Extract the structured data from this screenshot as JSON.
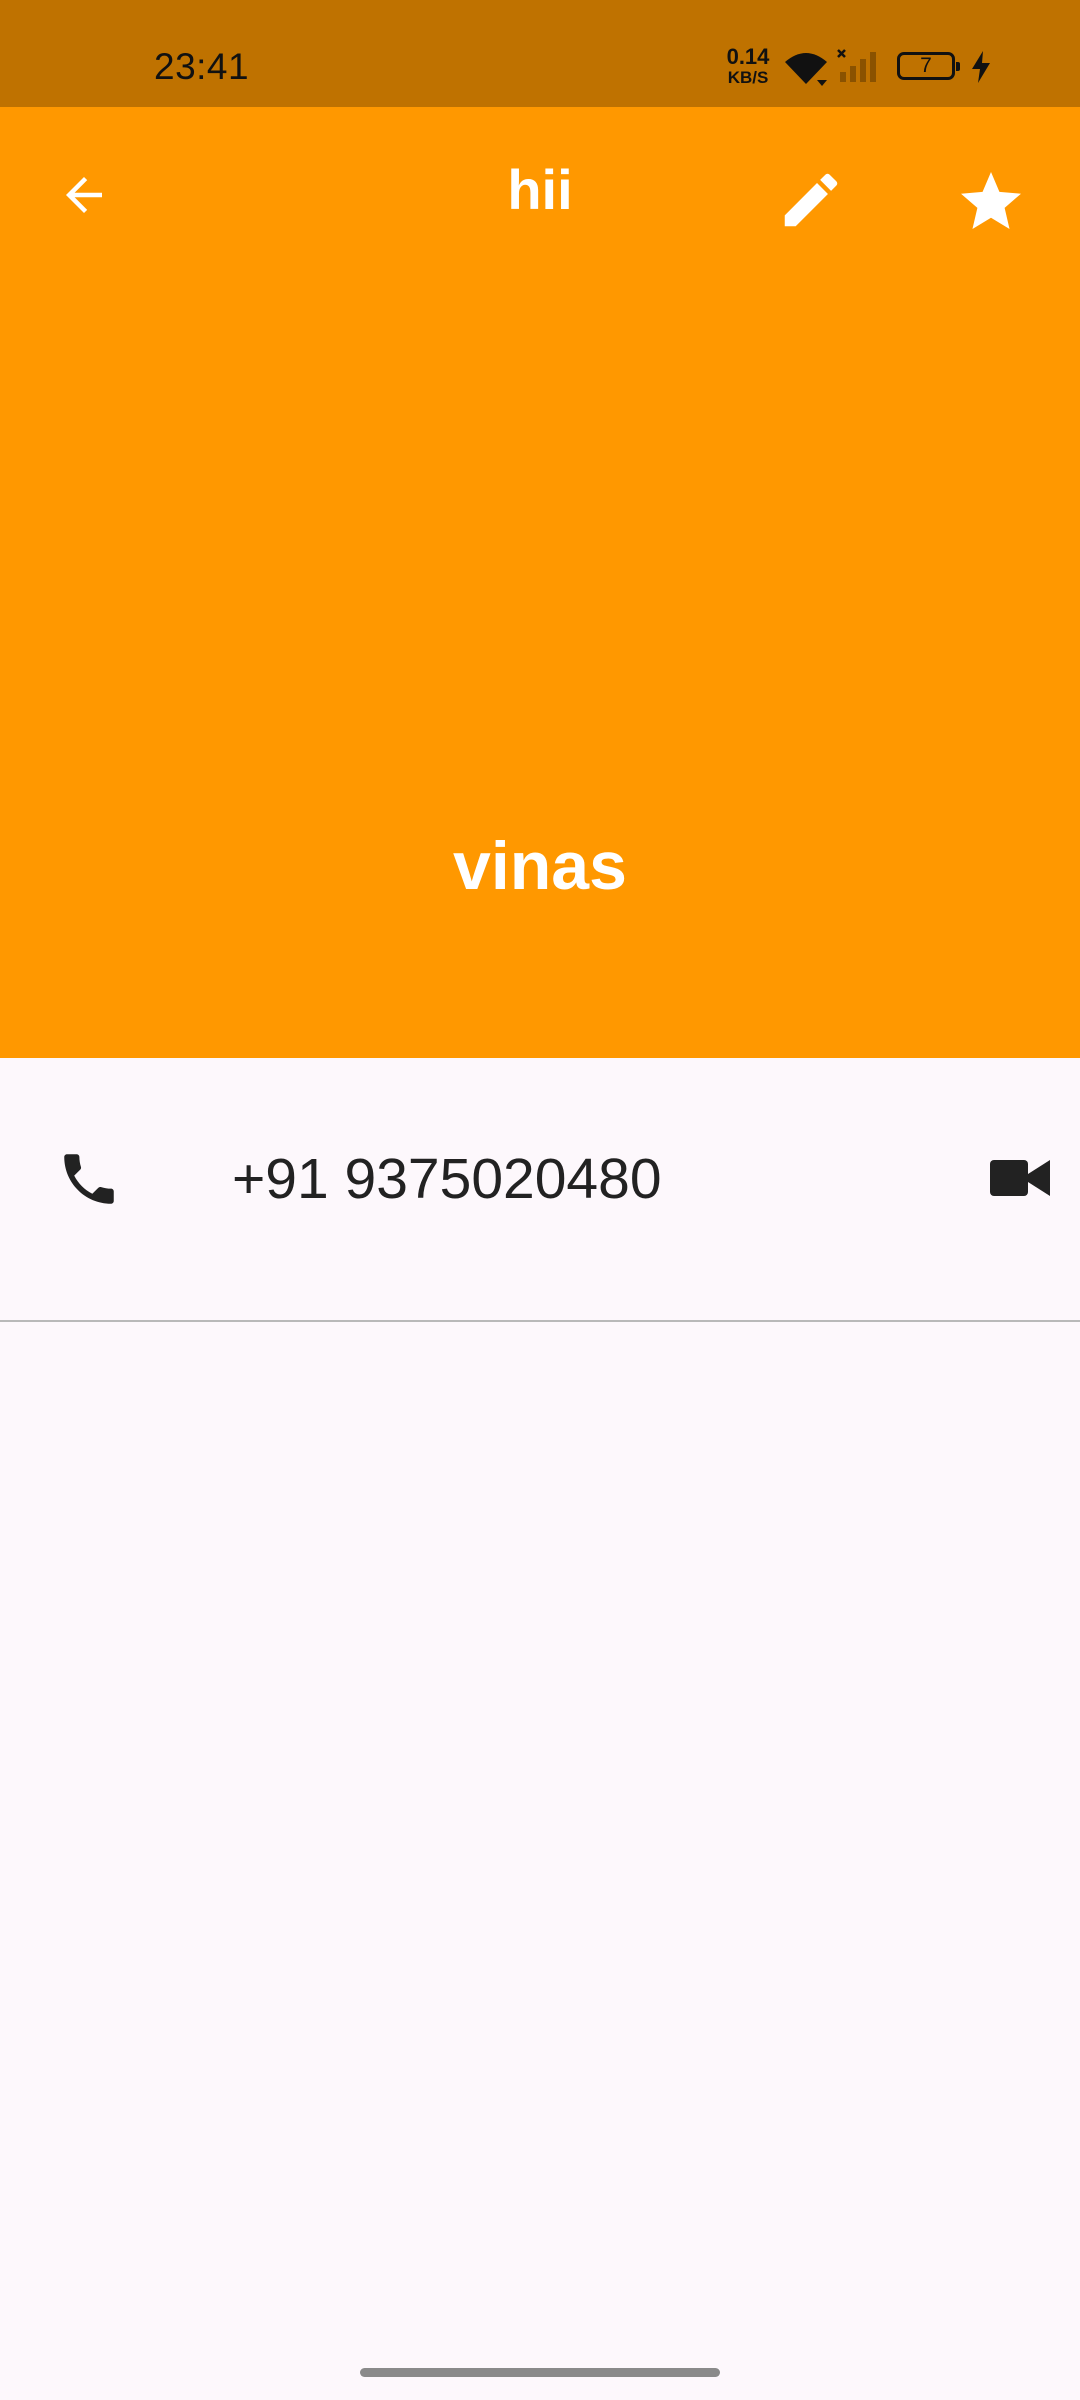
{
  "status_bar": {
    "time": "23:41",
    "net_speed_value": "0.14",
    "net_speed_unit": "KB/S",
    "battery_level": "7",
    "icons": [
      "wifi-icon",
      "signal-icon",
      "battery-icon",
      "charging-icon"
    ]
  },
  "header": {
    "title": "hii",
    "contact_name": "vinas",
    "background_color": "#ff9800",
    "icons": [
      "back-arrow-icon",
      "edit-pencil-icon",
      "star-icon"
    ]
  },
  "phone_entry": {
    "number": "+91 9375020480",
    "icons": [
      "phone-icon",
      "video-call-icon"
    ]
  },
  "colors": {
    "status_bar": "#bf7200",
    "accent": "#ff9800",
    "page_background": "#fdf8fc"
  }
}
